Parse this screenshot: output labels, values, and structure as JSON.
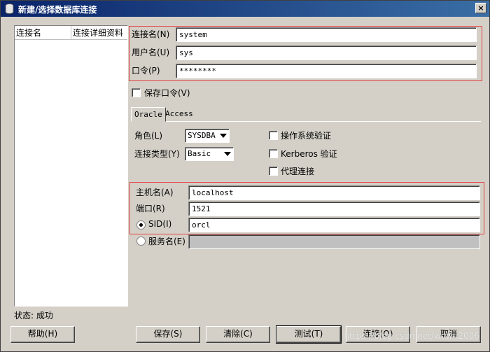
{
  "window": {
    "title": "新建/选择数据库连接",
    "close_glyph": "×"
  },
  "list": {
    "columns": [
      "连接名",
      "连接详细资料"
    ]
  },
  "status": "状态: 成功",
  "credentials": {
    "conn_name_label": "连接名(N)",
    "conn_name_value": "system",
    "username_label": "用户名(U)",
    "username_value": "sys",
    "password_label": "口令(P)",
    "password_value": "********",
    "save_password_label": "保存口令(V)"
  },
  "tabs": [
    "Oracle",
    "Access"
  ],
  "options": {
    "role_label": "角色(L)",
    "role_value": "SYSDBA",
    "conn_type_label": "连接类型(Y)",
    "conn_type_value": "Basic",
    "os_auth_label": "操作系统验证",
    "kerberos_label": "Kerberos 验证",
    "proxy_label": "代理连接"
  },
  "host": {
    "hostname_label": "主机名(A)",
    "hostname_value": "localhost",
    "port_label": "端口(R)",
    "port_value": "1521",
    "sid_label": "SID(I)",
    "sid_value": "orcl",
    "service_label": "服务名(E)",
    "service_value": ""
  },
  "buttons": {
    "help": "帮助(H)",
    "save": "保存(S)",
    "clear": "清除(C)",
    "test": "测试(T)",
    "connect": "连接(O)",
    "cancel": "取消"
  },
  "watermark": "https://blog.csdn.net/wowu2006"
}
